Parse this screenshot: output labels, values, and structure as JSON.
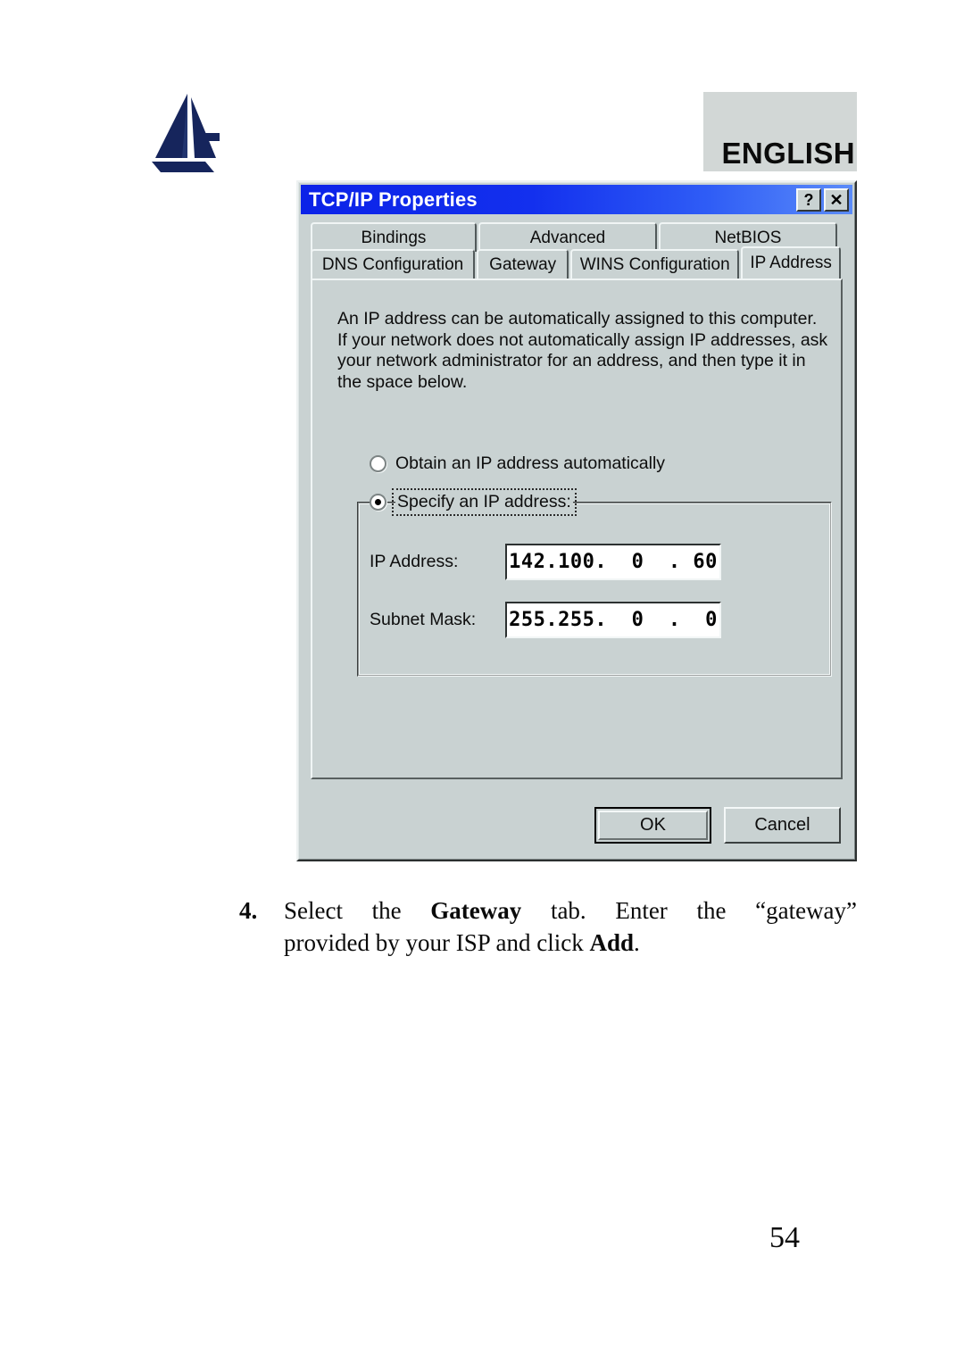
{
  "page": {
    "language_label": "ENGLISH",
    "page_number": "54",
    "logo_name": "atlantis-logo"
  },
  "dialog": {
    "title": "TCP/IP Properties",
    "titlebar_buttons": [
      {
        "name": "help-button",
        "glyph": "?"
      },
      {
        "name": "close-button",
        "glyph": "✕"
      }
    ],
    "tabs_row1": [
      {
        "label": "Bindings",
        "selected": false
      },
      {
        "label": "Advanced",
        "selected": false
      },
      {
        "label": "NetBIOS",
        "selected": false
      }
    ],
    "tabs_row2": [
      {
        "label": "DNS Configuration",
        "selected": false
      },
      {
        "label": "Gateway",
        "selected": false
      },
      {
        "label": "WINS Configuration",
        "selected": false
      },
      {
        "label": "IP Address",
        "selected": true
      }
    ],
    "description": {
      "line1": "An IP address can be automatically assigned to this computer.",
      "line2": "If your network does not automatically assign IP addresses, ask",
      "line3": "your network administrator for an address, and then type it in",
      "line4": "the space below."
    },
    "radio_obtain": {
      "label": "Obtain an IP address automatically",
      "selected": false
    },
    "radio_specify": {
      "label": "Specify an IP address:",
      "selected": true,
      "focused": true
    },
    "fields": {
      "ip_address_label": "IP Address:",
      "ip_address_value": "142.100.  0  . 60",
      "subnet_mask_label": "Subnet Mask:",
      "subnet_mask_value": "255.255.  0  .  0"
    },
    "buttons": {
      "ok": "OK",
      "cancel": "Cancel"
    }
  },
  "caption": {
    "number": "4.",
    "line1_part1": "Select",
    "line1_part2": "the",
    "line1_bold": "Gateway",
    "line1_part3": "tab. Enter",
    "line1_part4": "the",
    "line1_part5": "“gateway”",
    "line2_part1": "provided by your ISP and click",
    "line2_bold": "Add",
    "line2_part2": "."
  },
  "colors": {
    "dialog_face": "#c9d2d2",
    "titlebar_blue": "#0b22e8",
    "english_box": "#d2d7d6",
    "logo_navy": "#16255c"
  }
}
